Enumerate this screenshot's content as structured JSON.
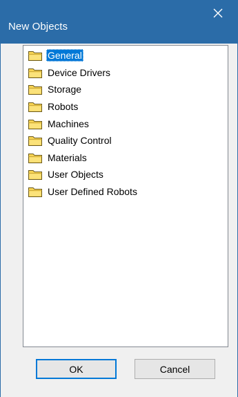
{
  "window": {
    "title": "New Objects",
    "close_icon": "close-icon",
    "titlebar_color": "#2b6ca8"
  },
  "tree": {
    "selected_index": 0,
    "items": [
      {
        "label": "General",
        "icon": "folder-icon"
      },
      {
        "label": "Device Drivers",
        "icon": "folder-icon"
      },
      {
        "label": "Storage",
        "icon": "folder-icon"
      },
      {
        "label": "Robots",
        "icon": "folder-icon"
      },
      {
        "label": "Machines",
        "icon": "folder-icon"
      },
      {
        "label": "Quality Control",
        "icon": "folder-icon"
      },
      {
        "label": "Materials",
        "icon": "folder-icon"
      },
      {
        "label": "User Objects",
        "icon": "folder-icon"
      },
      {
        "label": "User Defined Robots",
        "icon": "folder-icon"
      }
    ]
  },
  "buttons": {
    "ok_label": "OK",
    "cancel_label": "Cancel"
  },
  "colors": {
    "selection": "#0078d7",
    "folder": "#f7d353"
  }
}
